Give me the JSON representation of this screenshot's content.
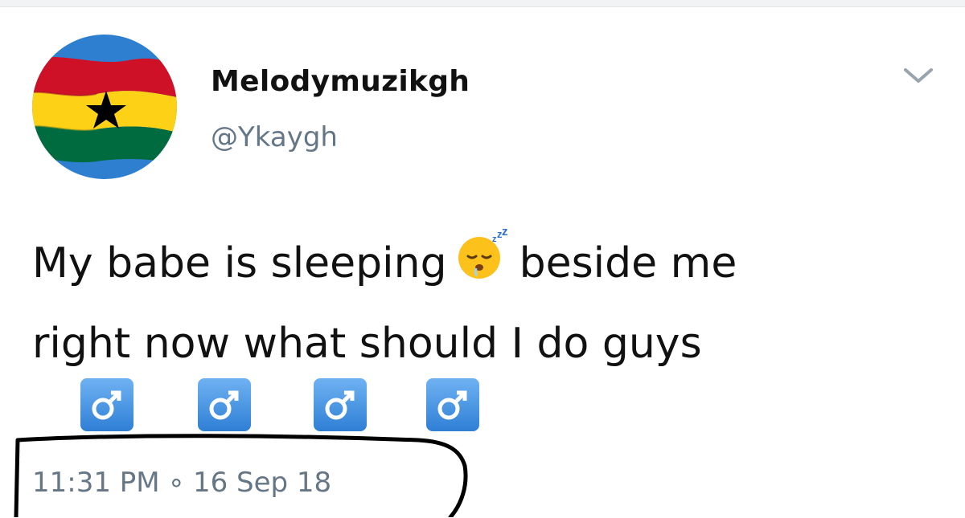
{
  "tweet": {
    "display_name": "Melodymuzikgh",
    "handle": "@Ykaygh",
    "text_line1_before": "My babe is sleeping",
    "text_line1_after": "beside me",
    "text_line2": "right now what should I do guys",
    "emoji_sleeping": "sleeping-face-icon",
    "male_signs": [
      "♂",
      "♂",
      "♂",
      "♂"
    ],
    "time": "11:31 PM",
    "separator": "∘",
    "date": "16 Sep 18"
  },
  "colors": {
    "flag_red": "#ce1126",
    "flag_yellow": "#fcd116",
    "flag_green": "#006b3f",
    "star": "#000000",
    "sky": "#2e7fd0",
    "secondary_text": "#657786",
    "tile_blue": "#3a8ee0"
  }
}
